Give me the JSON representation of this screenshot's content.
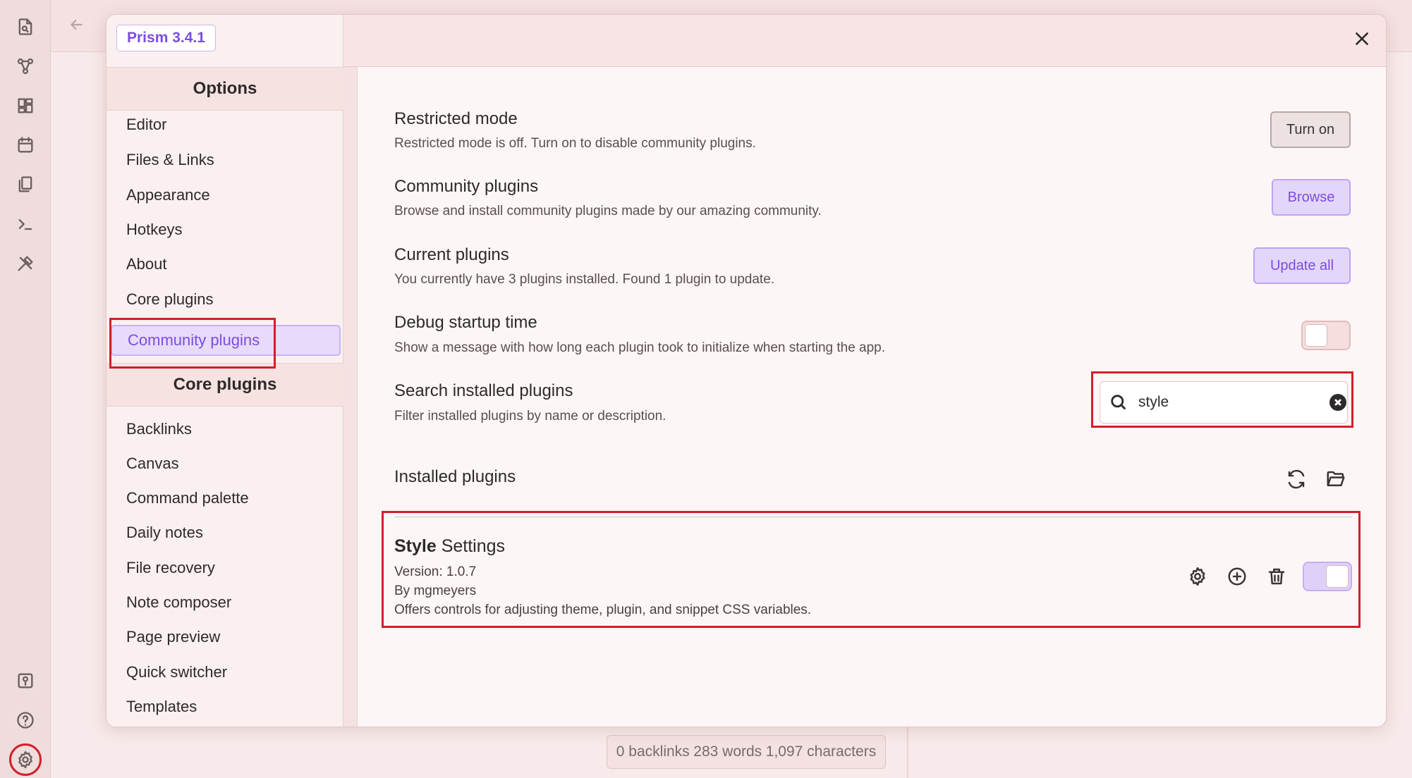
{
  "ribbon": {
    "top_icons": [
      "open-file-icon",
      "graph-view-icon",
      "canvas-icon",
      "daily-notes-icon",
      "templates-icon",
      "command-palette-icon",
      "style-settings-icon"
    ],
    "bottom_icons": [
      "vault-switcher-icon",
      "help-icon",
      "settings-icon"
    ]
  },
  "status_bar": {
    "backlinks": "0 backlinks",
    "words": "283 words",
    "characters": "1,097 characters"
  },
  "modal": {
    "version": "Prism 3.4.1",
    "sidebar": {
      "options_header": "Options",
      "options_items": [
        "Editor",
        "Files & Links",
        "Appearance",
        "Hotkeys",
        "About",
        "Core plugins",
        "Community plugins"
      ],
      "active_item": "Community plugins",
      "core_header": "Core plugins",
      "core_items": [
        "Backlinks",
        "Canvas",
        "Command palette",
        "Daily notes",
        "File recovery",
        "Note composer",
        "Page preview",
        "Quick switcher",
        "Templates"
      ]
    },
    "settings": {
      "restricted": {
        "title": "Restricted mode",
        "desc": "Restricted mode is off. Turn on to disable community plugins.",
        "button": "Turn on"
      },
      "community": {
        "title": "Community plugins",
        "desc": "Browse and install community plugins made by our amazing community.",
        "button": "Browse"
      },
      "current": {
        "title": "Current plugins",
        "desc": "You currently have 3 plugins installed. Found 1 plugin to update.",
        "button": "Update all"
      },
      "debug": {
        "title": "Debug startup time",
        "desc": "Show a message with how long each plugin took to initialize when starting the app.",
        "enabled": false
      },
      "search": {
        "title": "Search installed plugins",
        "desc": "Filter installed plugins by name or description.",
        "value": "style"
      }
    },
    "installed": {
      "heading": "Installed plugins",
      "plugins": [
        {
          "name_match": "Style",
          "name_rest": " Settings",
          "version": "Version: 1.0.7",
          "author": "By mgmeyers",
          "desc": "Offers controls for adjusting theme, plugin, and snippet CSS variables.",
          "enabled": true
        }
      ]
    }
  },
  "colors": {
    "accent": "#7a4ee0",
    "highlight_box": "#d0202a",
    "background": "#f1dede"
  }
}
